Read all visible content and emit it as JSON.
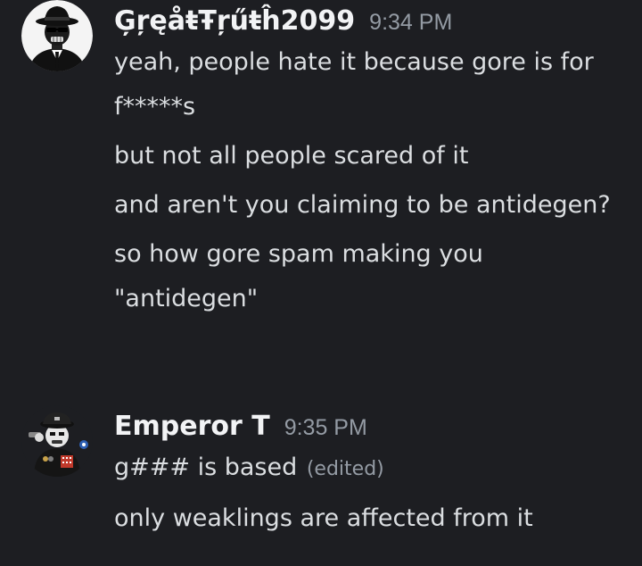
{
  "messages": [
    {
      "username": "ĢŗęåŧŦŗűŧĥ2099",
      "timestamp": "9:34 PM",
      "avatar_icon": "fedora-mask-avatar-icon",
      "lines": [
        "yeah, people hate it because gore is for f*****s",
        "but not all people scared of it",
        "and aren't you claiming to be antidegen?",
        "so how gore spam making you \"antidegen\""
      ]
    },
    {
      "username": "Emperor T",
      "timestamp": "9:35 PM",
      "avatar_icon": "officer-cap-avatar-icon",
      "lines": [
        "g### is based",
        "only weaklings are affected from it"
      ],
      "edited_label": "(edited)"
    }
  ],
  "colors": {
    "background": "#1d1e22",
    "username": "#f2f3f5",
    "message_text": "#dbdee1",
    "muted": "#949ba4"
  }
}
